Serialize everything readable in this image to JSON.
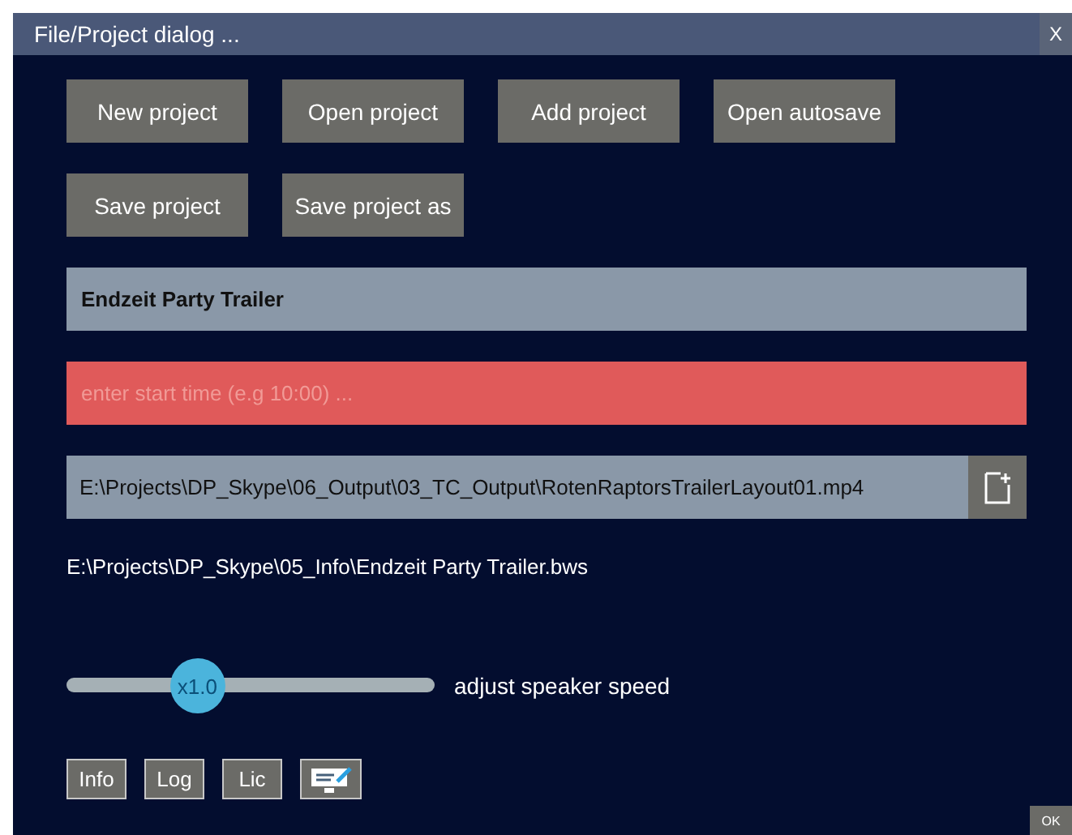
{
  "window": {
    "title": "File/Project dialog ...",
    "close": "X"
  },
  "buttons_row_1": [
    "New project",
    "Open project",
    "Add project",
    "Open autosave"
  ],
  "buttons_row_2": [
    "Save project",
    "Save project as"
  ],
  "project_name": {
    "value": "Endzeit Party Trailer"
  },
  "start_time": {
    "placeholder": "enter start time (e.g 10:00) ...",
    "invalid": true
  },
  "output_path": {
    "value": "E:\\Projects\\DP_Skype\\06_Output\\03_TC_Output\\RotenRaptorsTrailerLayout01.mp4"
  },
  "project_file": "E:\\Projects\\DP_Skype\\05_Info\\Endzeit Party Trailer.bws",
  "speed": {
    "level": 0.33,
    "thumb": "x1.0",
    "label": "adjust speaker speed"
  },
  "small_buttons": [
    "Info",
    "Log",
    "Lic"
  ],
  "ok": "OK"
}
